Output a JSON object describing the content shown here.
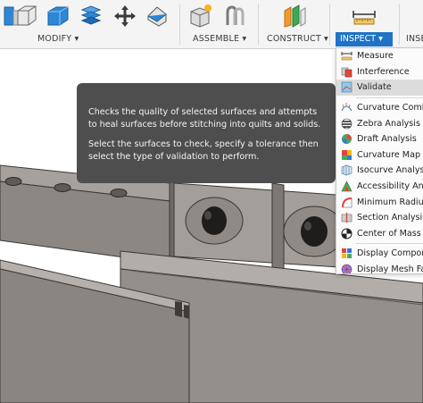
{
  "toolbar": {
    "groups": {
      "modify": "MODIFY ▾",
      "assemble": "ASSEMBLE ▾",
      "construct": "CONSTRUCT ▾",
      "inspect": "INSPECT ▾",
      "insert_partial": "INSE"
    }
  },
  "inspect_menu": {
    "items": [
      {
        "label": "Measure",
        "icon": "measure-icon"
      },
      {
        "label": "Interference",
        "icon": "interference-icon"
      },
      {
        "label": "Validate",
        "icon": "validate-icon",
        "selected": true
      },
      {
        "label": "Curvature Comb A",
        "icon": "curvature-comb-icon"
      },
      {
        "label": "Zebra Analysis",
        "icon": "zebra-icon"
      },
      {
        "label": "Draft Analysis",
        "icon": "draft-icon"
      },
      {
        "label": "Curvature Map An",
        "icon": "curvature-map-icon"
      },
      {
        "label": "Isocurve Analysis",
        "icon": "isocurve-icon"
      },
      {
        "label": "Accessibility Ana",
        "icon": "accessibility-icon"
      },
      {
        "label": "Minimum Radius A",
        "icon": "minimum-radius-icon"
      },
      {
        "label": "Section Analysis",
        "icon": "section-icon"
      },
      {
        "label": "Center of Mass",
        "icon": "center-of-mass-icon"
      },
      {
        "label": "Display Compone",
        "icon": "display-component-icon"
      },
      {
        "label": "Display Mesh Fac",
        "icon": "display-mesh-icon"
      }
    ]
  },
  "tooltip": {
    "line1": "Checks the quality of selected surfaces and attempts",
    "line2": "to heal surfaces before stitching into quilts and solids.",
    "line3": "Select the surfaces to check, specify a tolerance then",
    "line4": "select the type of validation to perform."
  },
  "colors": {
    "accent": "#1f73c7",
    "tooltip_bg": "#4e4e4e",
    "model_gray": "#8c8783",
    "model_edge": "#3a3633"
  }
}
